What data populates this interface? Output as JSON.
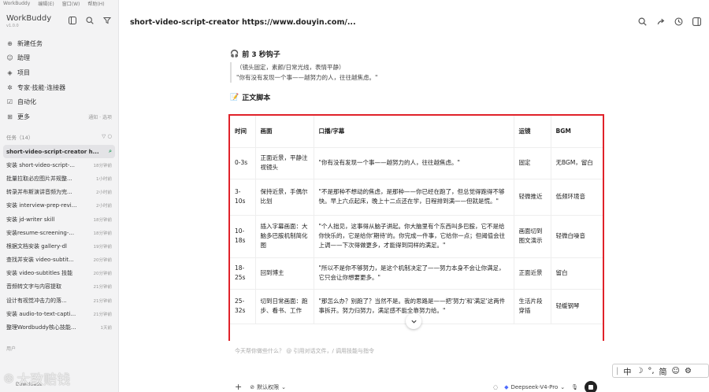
{
  "app": {
    "menu": [
      "WorkBuddy",
      "编辑(E)",
      "窗口(W)",
      "帮助(H)"
    ],
    "name": "WorkBuddy",
    "version": "v1.0.0"
  },
  "nav": [
    {
      "icon": "plus-circle-icon",
      "label": "新建任务"
    },
    {
      "icon": "assistant-icon",
      "label": "助理"
    },
    {
      "icon": "stack-icon",
      "label": "项目"
    },
    {
      "icon": "tools-icon",
      "label": "专家·技能·连接器"
    },
    {
      "icon": "check-icon",
      "label": "自动化"
    },
    {
      "icon": "more-icon",
      "label": "更多",
      "right": "通知 · 选项"
    }
  ],
  "tasks_header": {
    "label": "任务（14）",
    "right": "▽ ○"
  },
  "tasks": [
    {
      "name": "short-video-script-creator h...",
      "time": "",
      "active": true
    },
    {
      "name": "安装 short-video-script-...",
      "time": "18分钟前"
    },
    {
      "name": "批量拉取必应图片并规整...",
      "time": "1小时前"
    },
    {
      "name": "转录并布斯演讲音频为完...",
      "time": "2小时前"
    },
    {
      "name": "安装 interview-prep-revi...",
      "time": "2小时前"
    },
    {
      "name": "安装 jd-writer skill",
      "time": "18分钟前"
    },
    {
      "name": "安装resume-screening-...",
      "time": "18分钟前"
    },
    {
      "name": "根据文档安装 gallery-dl",
      "time": "19分钟前"
    },
    {
      "name": "查找并安装 video-subtit...",
      "time": "20分钟前"
    },
    {
      "name": "安装 video-subtitles 技能",
      "time": "20分钟前"
    },
    {
      "name": "音频转文字与内容提取",
      "time": "21分钟前"
    },
    {
      "name": "设计有视觉冲击力的落...",
      "time": "21分钟前"
    },
    {
      "name": "安装 audio-to-text-capti...",
      "time": "21分钟前"
    },
    {
      "name": "整理Wordbuddy核心技能...",
      "time": "1天前"
    }
  ],
  "side_footer": "用户",
  "watermark": "大致赔钱",
  "download_label": "Downloads",
  "main": {
    "title": "short-video-script-creator https://www.douyin.com/...",
    "hook_title": "前 3 秒钩子",
    "hook_lines": [
      "（镜头固定，素颜/日常光线，表情平静）",
      "\"你有没有发现一个事——越努力的人，往往越焦虑。\""
    ],
    "body_title": "正文脚本",
    "table": {
      "headers": [
        "时间",
        "画面",
        "口播/字幕",
        "运镜",
        "BGM"
      ],
      "rows": [
        [
          "0-3s",
          "正面近景，平静注视镜头",
          "\"你有没有发现一个事——越努力的人，往往越焦虑。\"",
          "固定",
          "无BGM，留白"
        ],
        [
          "3-10s",
          "保持近景，手偶尔比划",
          "\"不是那种不想动的焦虑，是那种——你已经在跑了，但总觉得跑得不够快。早上六点起床，晚上十二点还在学，日程排到满——但就是慌。\"",
          "轻微推近",
          "低频环境音"
        ],
        [
          "10-18s",
          "插入字幕画面：大脑多巴胺机制简化图",
          "\"个人拙见，这事得从脑子讲起。你大脑里有个东西叫多巴胺，它不是给你快乐的，它是给你'期待'的。你完成一件事，它给你一点；但阈值会往上调——下次得做更多，才能得到同样的满足。\"",
          "画面切到图文演示",
          "轻微白噪音"
        ],
        [
          "18-25s",
          "回到博主",
          "\"所以不是你不够努力，是这个机制决定了——努力本身不会让你满足，它只会让你想要更多。\"",
          "正面近景",
          "留白"
        ],
        [
          "25-32s",
          "切到日常画面：跑步、看书、工作",
          "\"那怎么办？别跑了？当然不是。我的思路是——把'努力'和'满足'这两件事拆开。努力归努力，满足感不能全靠努力给。\"",
          "生活片段穿插",
          "轻缓钢琴"
        ]
      ]
    },
    "input_placeholder": "今天帮你做些什么？ @ 引用对话文件，/ 调用技能与指令",
    "permission_label": "默认权限",
    "model_label": "Deepseek-V4-Pro"
  },
  "ime": [
    "中",
    "简"
  ]
}
